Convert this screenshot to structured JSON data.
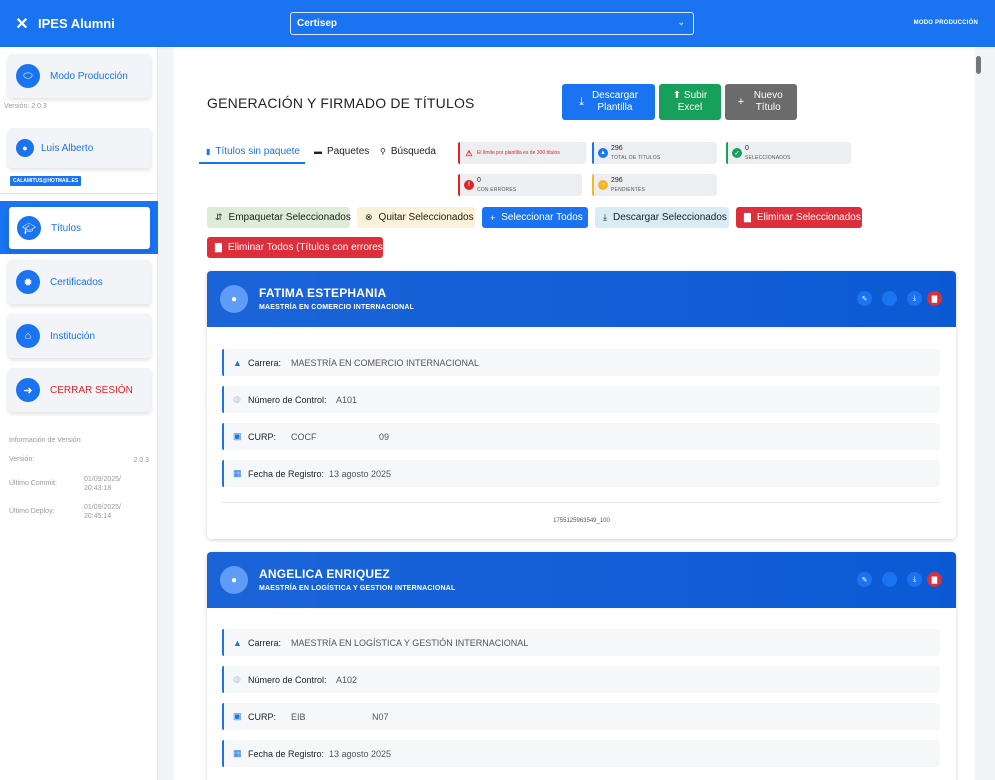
{
  "topbar": {
    "app_title": "IPES Alumni",
    "org_select": "Certisep",
    "mode_label": "MODO PRODUCCIÓN"
  },
  "sidebar": {
    "mode_button": "Modo Producción",
    "version_short": "Versión: 2.0.3",
    "user_name": "Luis Alberto",
    "user_email": "CALAMITUS@HOTMAIL.ES",
    "nav": [
      {
        "label": "Títulos",
        "icon": "graduation-cap-icon"
      },
      {
        "label": "Certificados",
        "icon": "certificate-icon"
      },
      {
        "label": "Institución",
        "icon": "bank-icon"
      },
      {
        "label": "CERRAR SESIÓN",
        "icon": "logout-icon"
      }
    ],
    "version_info": {
      "heading": "Información de Versión",
      "version_label": "Versión:",
      "version_value": "2.0.3",
      "commit_label": "Último Commit:",
      "commit_value": "01/09/2025/ 20:43:18",
      "deploy_label": "Último Deploy:",
      "deploy_value": "01/09/2025/ 20:45:14"
    }
  },
  "page": {
    "title": "GENERACIÓN Y FIRMADO DE TÍTULOS",
    "header_buttons": {
      "download_template": "Descargar Plantilla",
      "upload_excel": "Subir Excel",
      "new_title": "Nuevo Título"
    },
    "tabs": [
      {
        "label": "Títulos sin paquete",
        "active": true
      },
      {
        "label": "Paquetes",
        "active": false
      },
      {
        "label": "Búsqueda",
        "active": false
      }
    ],
    "stats": {
      "limit_warning": "El límite por plantilla es de 300 títulos",
      "total_value": "296",
      "total_caption": "TOTAL DE TÍTULOS",
      "selected_value": "0",
      "selected_caption": "SELECCIONADOS",
      "errors_value": "0",
      "errors_caption": "CON ERRORES",
      "pending_value": "296",
      "pending_caption": "PENDIENTES"
    },
    "actions": {
      "pack_selected": "Empaquetar Seleccionados",
      "remove_selected": "Quitar Seleccionados",
      "select_all": "Seleccionar Todos",
      "download_selected": "Descargar Seleccionados",
      "delete_selected": "Eliminar Seleccionados",
      "delete_all_errors": "Eliminar Todos (Títulos con errores)"
    },
    "field_labels": {
      "career": "Carrera:",
      "control_number": "Número de Control:",
      "curp": "CURP:",
      "registration_date": "Fecha de Registro:"
    },
    "records": [
      {
        "name": "FATIMA ESTEPHANIA",
        "program": "MAESTRÍA EN COMERCIO INTERNACIONAL",
        "career": "MAESTRÍA EN COMERCIO INTERNACIONAL",
        "control_number": "A101",
        "curp_start": "COCF",
        "curp_end": "09",
        "registration_date": "13 agosto 2025",
        "record_id": "1755125963549_100"
      },
      {
        "name": "ANGELICA ENRIQUEZ",
        "program": "MAESTRÍA EN LOGÍSTICA Y GESTION INTERNACIONAL",
        "career": "MAESTRÍA EN LOGÍSTICA Y GESTIÓN INTERNACIONAL",
        "control_number": "A102",
        "curp_start": "EIB",
        "curp_end": "N07",
        "registration_date": "13 agosto 2025"
      }
    ]
  },
  "colors": {
    "primary": "#1a73f0",
    "success": "#16a05a",
    "danger": "#dc2f3b",
    "neutral": "#6b6b6b"
  }
}
